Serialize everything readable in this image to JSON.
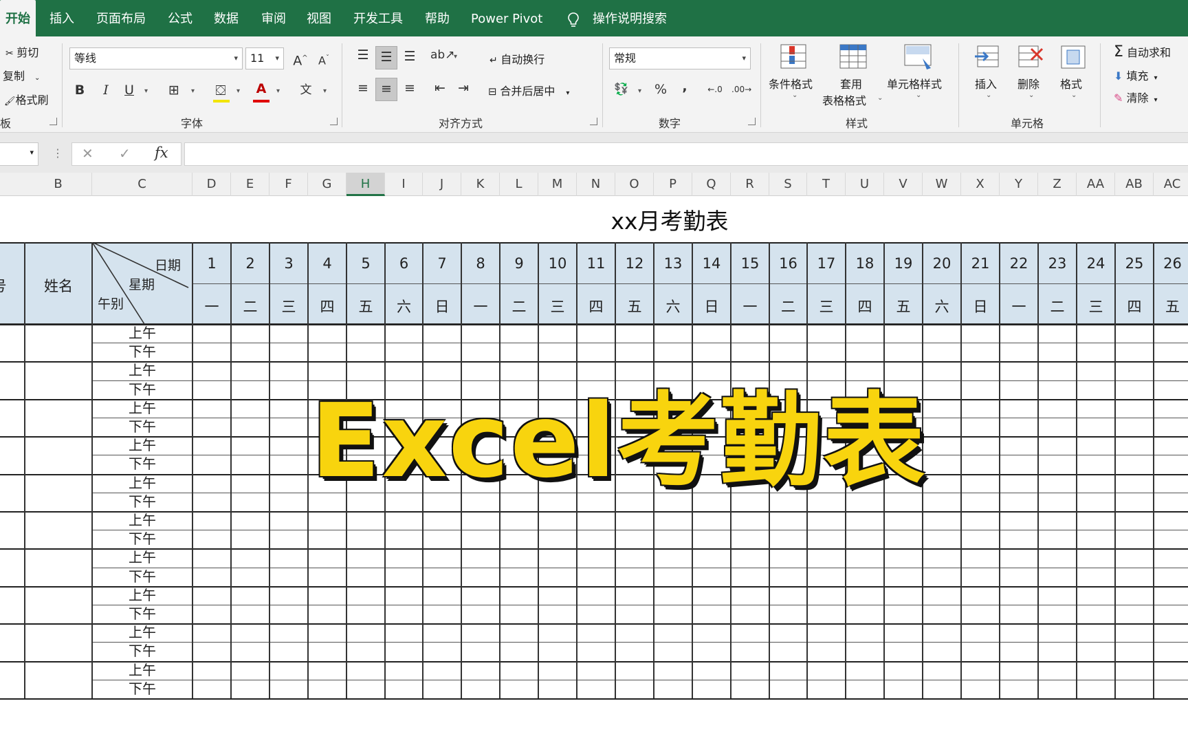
{
  "tabs": [
    {
      "label": "开始",
      "active": true
    },
    {
      "label": "插入"
    },
    {
      "label": "页面布局"
    },
    {
      "label": "公式"
    },
    {
      "label": "数据"
    },
    {
      "label": "审阅"
    },
    {
      "label": "视图"
    },
    {
      "label": "开发工具"
    },
    {
      "label": "帮助"
    },
    {
      "label": "Power Pivot"
    },
    {
      "label": "操作说明搜索"
    }
  ],
  "ribbon": {
    "clipboard": {
      "cut": "剪切",
      "copy": "复制",
      "format_painter": "格式刷",
      "label": "板"
    },
    "font": {
      "name": "等线",
      "size": "11",
      "grow": "A",
      "shrink": "A",
      "bold": "B",
      "italic": "I",
      "underline": "U",
      "color_letter": "A",
      "phonetic": "文",
      "label": "字体"
    },
    "alignment": {
      "wrap": "自动换行",
      "merge": "合并后居中",
      "label": "对齐方式"
    },
    "number": {
      "format": "常规",
      "percent": "%",
      "comma": ",",
      "label": "数字"
    },
    "styles": {
      "conditional": "条件格式",
      "table_line1": "套用",
      "table_line2": "表格格式",
      "cell_styles": "单元格样式",
      "label": "样式"
    },
    "cells": {
      "insert": "插入",
      "delete": "删除",
      "format": "格式",
      "label": "单元格"
    },
    "editing": {
      "sigma": "Σ",
      "autosum": "自动求和",
      "fill": "填充",
      "clear": "清除"
    }
  },
  "formula_bar": {
    "cancel": "✕",
    "enter": "✓",
    "fx": "fx",
    "value": ""
  },
  "columns": [
    "B",
    "C",
    "D",
    "E",
    "F",
    "G",
    "H",
    "I",
    "J",
    "K",
    "L",
    "M",
    "N",
    "O",
    "P",
    "Q",
    "R",
    "S",
    "T",
    "U",
    "V",
    "W",
    "X",
    "Y",
    "Z",
    "AA",
    "AB",
    "AC"
  ],
  "selected_column": "H",
  "sheet": {
    "title": "xx月考勤表",
    "header_no_partial": "号",
    "header_name": "姓名",
    "diag_date": "日期",
    "diag_week": "星期",
    "diag_period": "午别",
    "dates": [
      "1",
      "2",
      "3",
      "4",
      "5",
      "6",
      "7",
      "8",
      "9",
      "10",
      "11",
      "12",
      "13",
      "14",
      "15",
      "16",
      "17",
      "18",
      "19",
      "20",
      "21",
      "22",
      "23",
      "24",
      "25",
      "26"
    ],
    "weekdays": [
      "一",
      "二",
      "三",
      "四",
      "五",
      "六",
      "日",
      "一",
      "二",
      "三",
      "四",
      "五",
      "六",
      "日",
      "一",
      "二",
      "三",
      "四",
      "五",
      "六",
      "日",
      "一",
      "二",
      "三",
      "四",
      "五"
    ],
    "am": "上午",
    "pm": "下午"
  },
  "overlay": {
    "text": "Excel考勤表",
    "color": "#f8d40e"
  },
  "colors": {
    "brand": "#1f7145",
    "header_fill": "#d5e3ee"
  }
}
